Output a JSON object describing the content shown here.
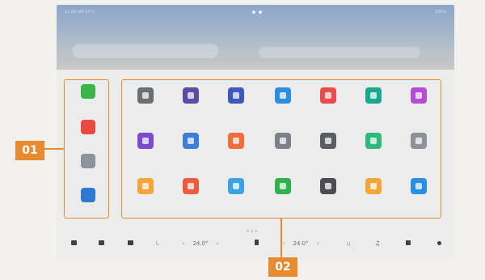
{
  "screen": {
    "status_left": "12:00 AM   24°C",
    "status_right": "100%"
  },
  "dock": {
    "apps": [
      {
        "name": "app-a",
        "color": "#3bb54a",
        "label": ""
      },
      {
        "name": "app-b",
        "color": "#e94a3f",
        "label": ""
      },
      {
        "name": "app-c",
        "color": "#8d939b",
        "label": ""
      },
      {
        "name": "app-d",
        "color": "#2d79d3",
        "label": ""
      }
    ]
  },
  "grid": {
    "rows": [
      [
        {
          "color": "#6b6e72",
          "label": ""
        },
        {
          "color": "#5a4ba3",
          "label": ""
        },
        {
          "color": "#3e59b7",
          "label": ""
        },
        {
          "color": "#2c8ee0",
          "label": ""
        },
        {
          "color": "#ea4b4b",
          "label": ""
        },
        {
          "color": "#1aa890",
          "label": ""
        },
        {
          "color": "#b24fd1",
          "label": ""
        }
      ],
      [
        {
          "color": "#7a4ad0",
          "label": ""
        },
        {
          "color": "#3d7fd7",
          "label": ""
        },
        {
          "color": "#ef6c3e",
          "label": ""
        },
        {
          "color": "#7e8288",
          "label": ""
        },
        {
          "color": "#5a5d62",
          "label": ""
        },
        {
          "color": "#31b87b",
          "label": ""
        },
        {
          "color": "#8e9298",
          "label": ""
        }
      ],
      [
        {
          "color": "#f1a63a",
          "label": ""
        },
        {
          "color": "#ec5c3f",
          "label": ""
        },
        {
          "color": "#3aa3e0",
          "label": ""
        },
        {
          "color": "#2fb24e",
          "label": ""
        },
        {
          "color": "#4a4c51",
          "label": ""
        },
        {
          "color": "#f4a53c",
          "label": ""
        },
        {
          "color": "#2a8ee2",
          "label": ""
        }
      ]
    ]
  },
  "bottombar": {
    "temp_left": "24.0°",
    "temp_right": "24.0°"
  },
  "callouts": {
    "label_01": "01",
    "label_02": "02",
    "accent": "#e88a2f"
  }
}
